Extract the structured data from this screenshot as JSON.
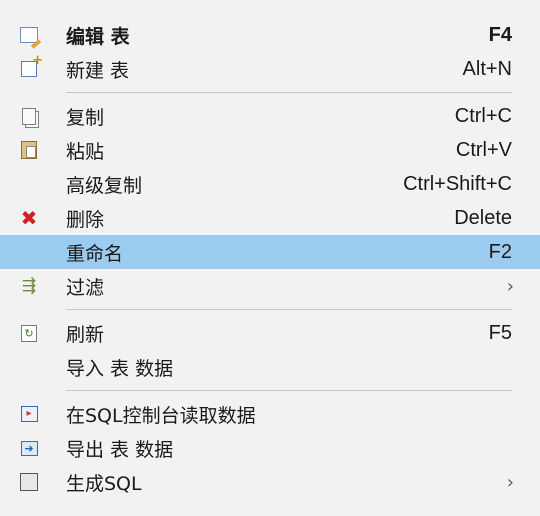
{
  "menu": {
    "items": [
      {
        "label": "编辑 表",
        "shortcut": "F4",
        "icon": "edit-table-icon"
      },
      {
        "label": "新建 表",
        "shortcut": "Alt+N",
        "icon": "new-table-icon"
      },
      {
        "label": "复制",
        "shortcut": "Ctrl+C",
        "icon": "copy-icon"
      },
      {
        "label": "粘贴",
        "shortcut": "Ctrl+V",
        "icon": "paste-icon"
      },
      {
        "label": "高级复制",
        "shortcut": "Ctrl+Shift+C"
      },
      {
        "label": "删除",
        "shortcut": "Delete",
        "icon": "delete-icon"
      },
      {
        "label": "重命名",
        "shortcut": "F2"
      },
      {
        "label": "过滤",
        "submenu_arrow": "›",
        "icon": "filter-icon"
      },
      {
        "label": "刷新",
        "shortcut": "F5",
        "icon": "refresh-icon"
      },
      {
        "label": "导入 表 数据"
      },
      {
        "label": "在SQL控制台读取数据",
        "icon": "sql-console-read-icon"
      },
      {
        "label": "导出 表 数据",
        "icon": "export-data-icon"
      },
      {
        "label": "生成SQL",
        "submenu_arrow": "›",
        "icon": "generate-sql-icon"
      }
    ],
    "highlight_color": "#9ccbf0",
    "delete_icon_color": "#d21f1f"
  }
}
